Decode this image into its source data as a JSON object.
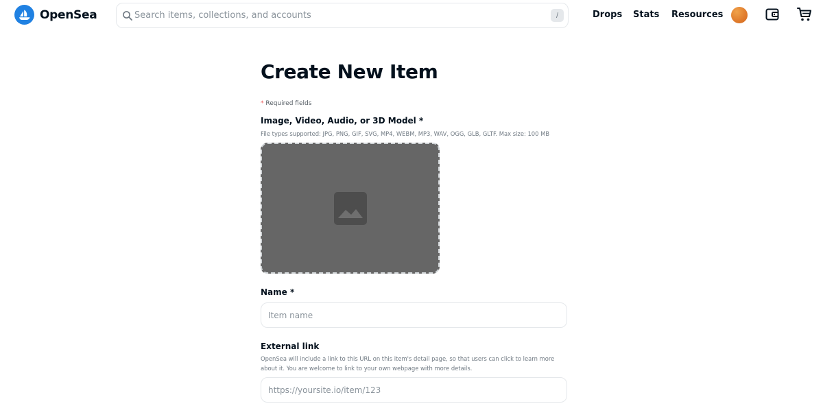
{
  "header": {
    "logo_text": "OpenSea",
    "search": {
      "placeholder": "Search items, collections, and accounts",
      "shortcut": "/"
    },
    "nav": [
      {
        "label": "Drops"
      },
      {
        "label": "Stats"
      },
      {
        "label": "Resources"
      }
    ],
    "icons": [
      "opensea-logo-icon",
      "search-icon",
      "avatar",
      "wallet-icon",
      "cart-icon"
    ]
  },
  "main": {
    "title": "Create New Item",
    "required_star": "*",
    "required_note": "Required fields",
    "media": {
      "label": "Image, Video, Audio, or 3D Model *",
      "subtitle": "File types supported: JPG, PNG, GIF, SVG, MP4, WEBM, MP3, WAV, OGG, GLB, GLTF. Max size: 100 MB",
      "icon": "image-icon"
    },
    "name": {
      "label": "Name *",
      "placeholder": "Item name",
      "value": ""
    },
    "external_link": {
      "label": "External link",
      "subtitle": "OpenSea will include a link to this URL on this item's detail page, so that users can click to learn more about it. You are welcome to link to your own webpage with more details.",
      "placeholder": "https://yoursite.io/item/123",
      "value": ""
    }
  },
  "colors": {
    "brand": "#2081e2",
    "text": "#04111d",
    "muted": "#707a83",
    "border": "#e5e8eb",
    "dropzone_fill": "#666666",
    "required_star": "#eb5757"
  }
}
